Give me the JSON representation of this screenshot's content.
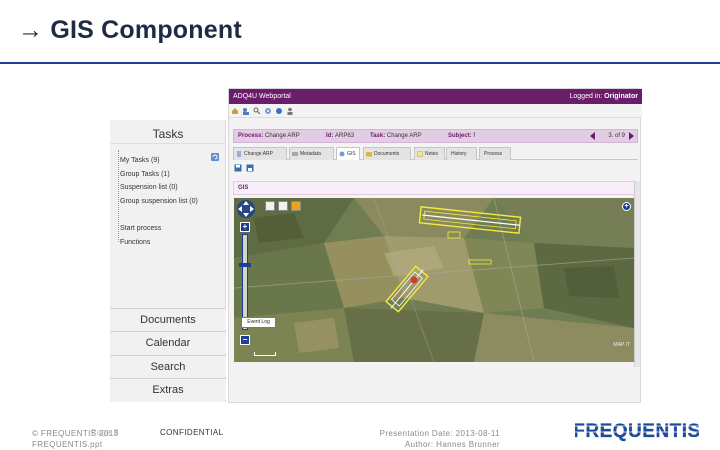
{
  "slide": {
    "title": "GIS Component",
    "arrow": "→"
  },
  "tasks_panel": {
    "header": "Tasks",
    "items": [
      "My Tasks (9)",
      "Group Tasks (1)",
      "Suspension list (0)",
      "Group suspension list (0)",
      "Start process",
      "Functions"
    ],
    "nav": [
      "Documents",
      "Calendar",
      "Search",
      "Extras"
    ]
  },
  "portal": {
    "name": "ADQ4U Webportal",
    "login_label": "Logged in:",
    "login_role": "Originator",
    "process_label": "Process:",
    "process_value": "Change ARP",
    "id_label": "Id:",
    "id_value": "ARP63",
    "task_label": "Task:",
    "task_value": "Change ARP",
    "subject_label": "Subject:",
    "subject_value": "f",
    "page_indicator": "3. of 9",
    "tabs": [
      "Change ARP",
      "Metadata",
      "GIS",
      "Documents",
      "Notes",
      "History",
      "Process"
    ],
    "active_tab": "GIS",
    "gis_heading": "GIS",
    "event_log": "Event Log",
    "map_source": "MAP IT",
    "accent_color": "#6a1d69"
  },
  "footer": {
    "copyright_line1": "© FREQUENTIS 2013",
    "copyright_line2": "FREQUENTIS.ppt",
    "page": "Page 8",
    "confidential": "CONFIDENTIAL",
    "presentation_date": "Presentation Date: 2013-08-11",
    "author": "Author: Hannes Brunner",
    "logo_text": "FREQUENTIS"
  }
}
